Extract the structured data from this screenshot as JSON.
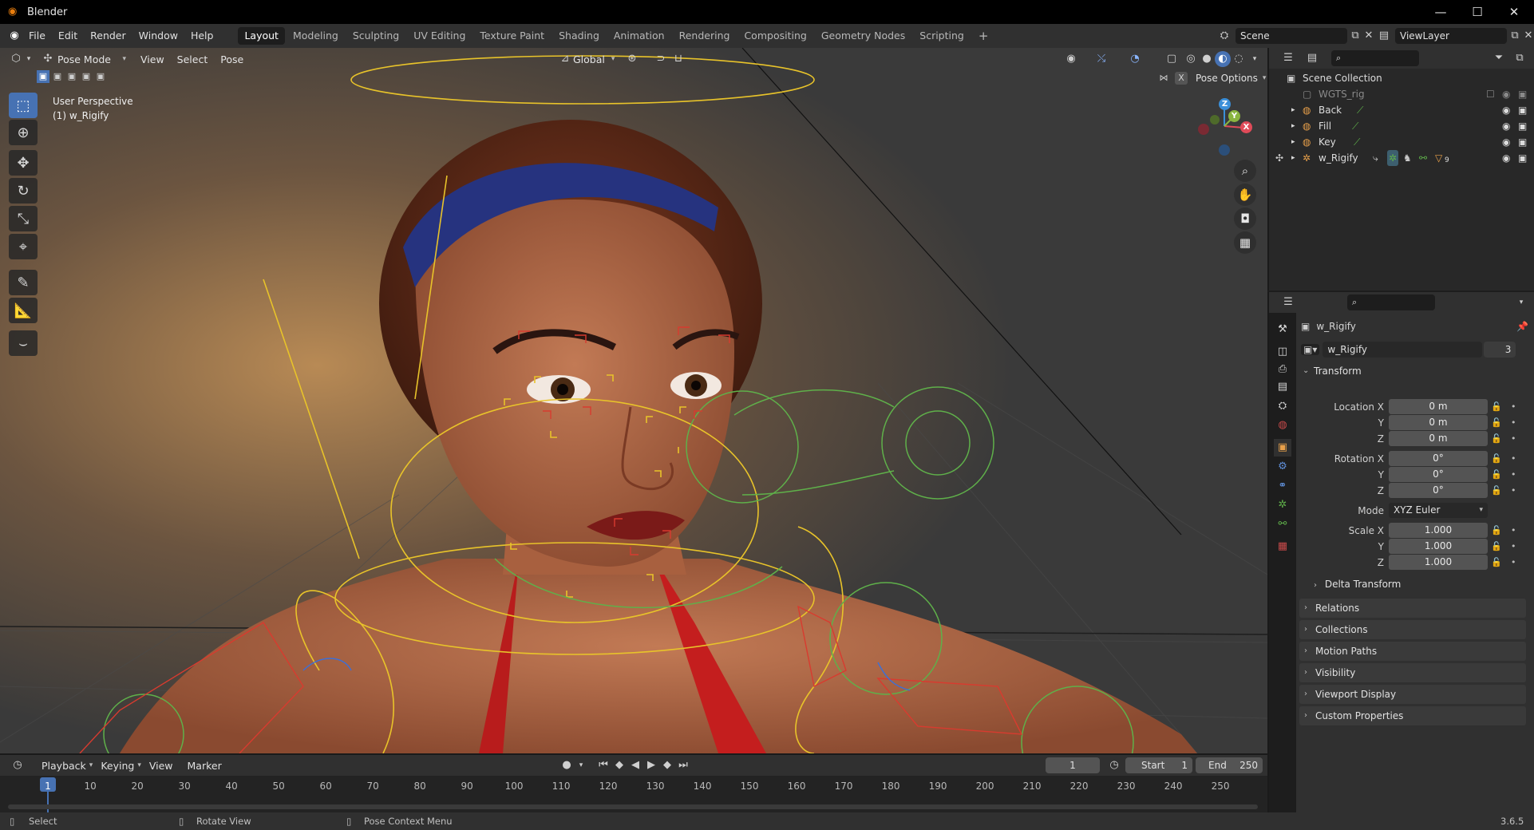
{
  "app": {
    "title": "Blender",
    "version": "3.6.5"
  },
  "window_controls": {
    "minimize": "—",
    "maximize": "☐",
    "close": "✕"
  },
  "menus": [
    "File",
    "Edit",
    "Render",
    "Window",
    "Help"
  ],
  "workspaces": [
    "Layout",
    "Modeling",
    "Sculpting",
    "UV Editing",
    "Texture Paint",
    "Shading",
    "Animation",
    "Rendering",
    "Compositing",
    "Geometry Nodes",
    "Scripting"
  ],
  "add_workspace": "+",
  "scene": {
    "name": "Scene",
    "view_layer": "ViewLayer"
  },
  "viewport": {
    "mode": "Pose Mode",
    "menus": [
      "View",
      "Select",
      "Pose"
    ],
    "orientation": "Global",
    "pose_options": "Pose Options",
    "perspective": "User Perspective",
    "object_label": "(1) w_Rigify",
    "gizmo": {
      "x": "X",
      "y": "Y",
      "z": "Z"
    }
  },
  "outliner": {
    "root": "Scene Collection",
    "items": [
      {
        "name": "WGTS_rig"
      },
      {
        "name": "Back"
      },
      {
        "name": "Fill"
      },
      {
        "name": "Key"
      },
      {
        "name": "w_Rigify"
      }
    ],
    "modifier_count": "9"
  },
  "properties": {
    "object_name": "w_Rigify",
    "data_name": "w_Rigify",
    "users": "3",
    "transform_title": "Transform",
    "location": {
      "label": "Location X",
      "x": "0 m",
      "y": "0 m",
      "z": "0 m"
    },
    "rotation": {
      "label": "Rotation X",
      "x": "0°",
      "y": "0°",
      "z": "0°"
    },
    "axis_y": "Y",
    "axis_z": "Z",
    "mode_label": "Mode",
    "mode_value": "XYZ Euler",
    "scale": {
      "label": "Scale X",
      "x": "1.000",
      "y": "1.000",
      "z": "1.000"
    },
    "delta_transform": "Delta Transform",
    "panels": [
      "Relations",
      "Collections",
      "Motion Paths",
      "Visibility",
      "Viewport Display",
      "Custom Properties"
    ]
  },
  "timeline": {
    "menus": [
      "Playback",
      "Keying",
      "View",
      "Marker"
    ],
    "current_frame": "1",
    "start_label": "Start",
    "start": "1",
    "end_label": "End",
    "end": "250",
    "ticks": [
      "1",
      "10",
      "20",
      "30",
      "40",
      "50",
      "60",
      "70",
      "80",
      "90",
      "100",
      "110",
      "120",
      "130",
      "140",
      "150",
      "160",
      "170",
      "180",
      "190",
      "200",
      "210",
      "220",
      "230",
      "240",
      "250"
    ]
  },
  "statusbar": {
    "select": "Select",
    "rotate": "Rotate View",
    "context": "Pose Context Menu"
  },
  "colors": {
    "accent": "#4772b3",
    "gizmo_x": "#e04b59",
    "gizmo_y": "#8ab540",
    "gizmo_z": "#3b8fd9",
    "bone_yellow": "#e8c32a",
    "bone_green": "#5fb04a",
    "bone_red": "#d83b2f"
  }
}
